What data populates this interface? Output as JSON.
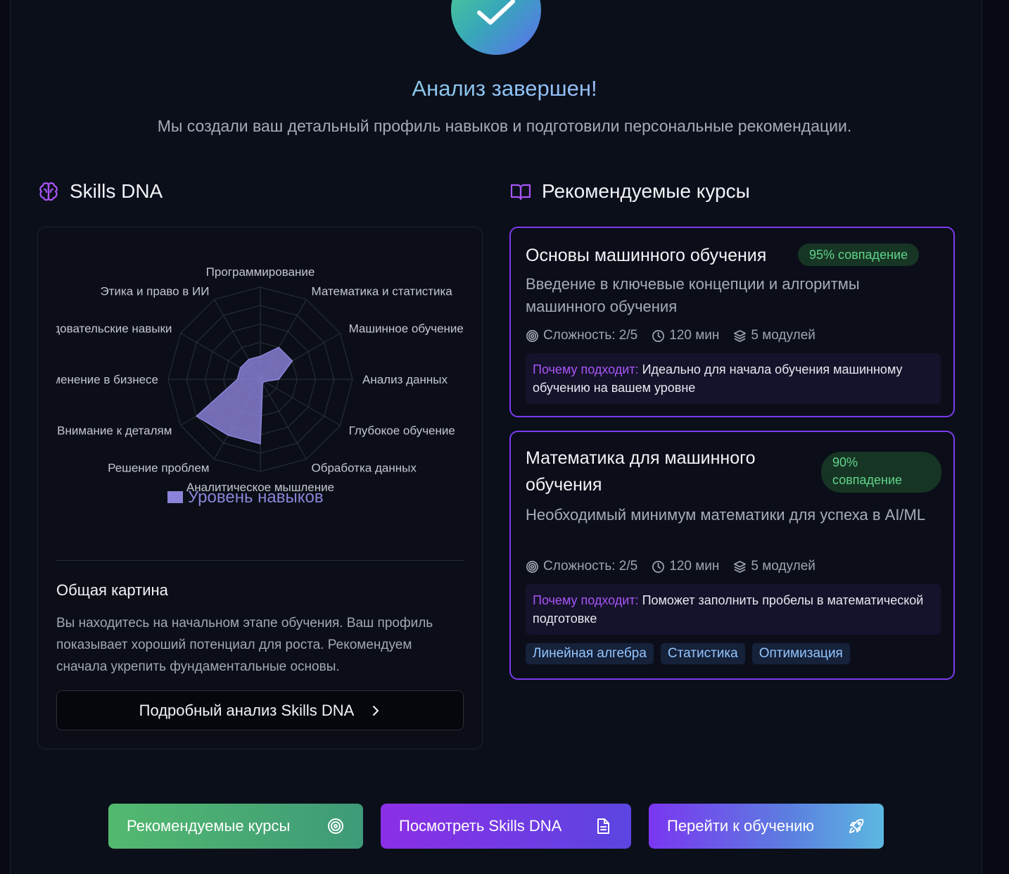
{
  "header": {
    "title": "Анализ завершен!",
    "subtitle": "Мы создали ваш детальный профиль навыков и подготовили персональные рекомендации."
  },
  "skills_section": {
    "heading": "Skills DNA",
    "icon": "brain-icon",
    "legend_label": "Уровень навыков",
    "overview_title": "Общая картина",
    "overview_text": "Вы находитесь на начальном этапе обучения. Ваш профиль показывает хороший потенциал для роста. Рекомендуем сначала укрепить фундаментальные основы.",
    "detail_button": "Подробный анализ Skills DNA"
  },
  "chart_data": {
    "type": "radar",
    "axes": [
      "Программирование",
      "Математика и статистика",
      "Машинное обучение",
      "Анализ данных",
      "Глубокое обучение",
      "Обработка данных",
      "Аналитическое мышление",
      "Решение проблем",
      "Внимание к деталям",
      "Применение в бизнесе",
      "Исследовательские навыки",
      "Этика и право в ИИ"
    ],
    "series": [
      {
        "name": "Уровень навыков",
        "values": [
          2.5,
          4,
          4,
          2,
          0.5,
          0.5,
          7,
          7,
          8,
          2.5,
          2.5,
          2.5
        ]
      }
    ],
    "rlim": [
      0,
      10
    ],
    "rings": 5,
    "color": "#8b83d9"
  },
  "courses_section": {
    "heading": "Рекомендуемые курсы",
    "icon": "book-open-icon",
    "courses": [
      {
        "title": "Основы машинного обучения",
        "match": "95% совпадение",
        "description": "Введение в ключевые концепции и алгоритмы машинного обучения",
        "difficulty": "Сложность: 2/5",
        "duration": "120 мин",
        "modules": "5 модулей",
        "why_label": "Почему подходит:",
        "why_text": " Идеально для начала обучения машинному обучению на вашем уровне",
        "tags": []
      },
      {
        "title": "Математика для машинного обучения",
        "match": "90% совпадение",
        "description": "Необходимый минимум математики для успеха в AI/ML",
        "difficulty": "Сложность: 2/5",
        "duration": "120 мин",
        "modules": "5 модулей",
        "why_label": "Почему подходит:",
        "why_text": " Поможет заполнить пробелы в математической подготовке",
        "tags": [
          "Линейная алгебра",
          "Статистика",
          "Оптимизация"
        ]
      }
    ]
  },
  "actions": {
    "courses": "Рекомендуемые курсы",
    "skills": "Посмотреть Skills DNA",
    "learn": "Перейти к обучению"
  },
  "colors": {
    "accent_purple": "#7c3aed",
    "match_green": "#5fd48a",
    "why_label": "#a855f7"
  }
}
